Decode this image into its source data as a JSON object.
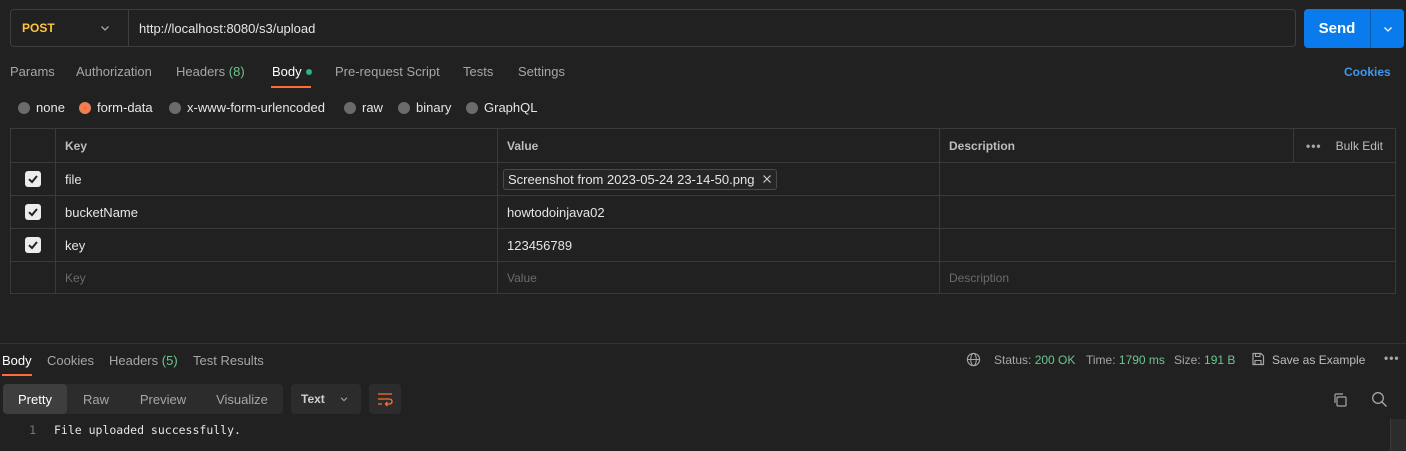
{
  "request": {
    "method": "POST",
    "url": "http://localhost:8080/s3/upload",
    "send_label": "Send"
  },
  "tabs": {
    "params": "Params",
    "authorization": "Authorization",
    "headers": "Headers",
    "headers_count": "(8)",
    "body": "Body",
    "prerequest": "Pre-request Script",
    "tests": "Tests",
    "settings": "Settings",
    "cookies": "Cookies"
  },
  "body_types": {
    "none": "none",
    "form_data": "form-data",
    "urlencoded": "x-www-form-urlencoded",
    "raw": "raw",
    "binary": "binary",
    "graphql": "GraphQL",
    "selected": "form-data"
  },
  "table": {
    "headers": {
      "key": "Key",
      "value": "Value",
      "description": "Description",
      "bulk_edit": "Bulk Edit"
    },
    "rows": [
      {
        "key": "file",
        "value": "Screenshot from 2023-05-24 23-14-50.png",
        "checked": true
      },
      {
        "key": "bucketName",
        "value": "howtodoinjava02",
        "checked": true
      },
      {
        "key": "key",
        "value": "123456789",
        "checked": true
      }
    ],
    "placeholder": {
      "key": "Key",
      "value": "Value",
      "description": "Description"
    }
  },
  "response": {
    "tabs": {
      "body": "Body",
      "cookies": "Cookies",
      "headers": "Headers",
      "headers_count": "(5)",
      "test_results": "Test Results"
    },
    "status_label": "Status:",
    "status_value": "200 OK",
    "time_label": "Time:",
    "time_value": "1790 ms",
    "size_label": "Size:",
    "size_value": "191 B",
    "save_example": "Save as Example",
    "views": {
      "pretty": "Pretty",
      "raw": "Raw",
      "preview": "Preview",
      "visualize": "Visualize"
    },
    "format": "Text",
    "line_number": "1",
    "content": "File uploaded successfully."
  },
  "colors": {
    "accent": "#ff6c37",
    "send": "#097bed",
    "method": "#ffc43d",
    "ok": "#6cc68d"
  }
}
